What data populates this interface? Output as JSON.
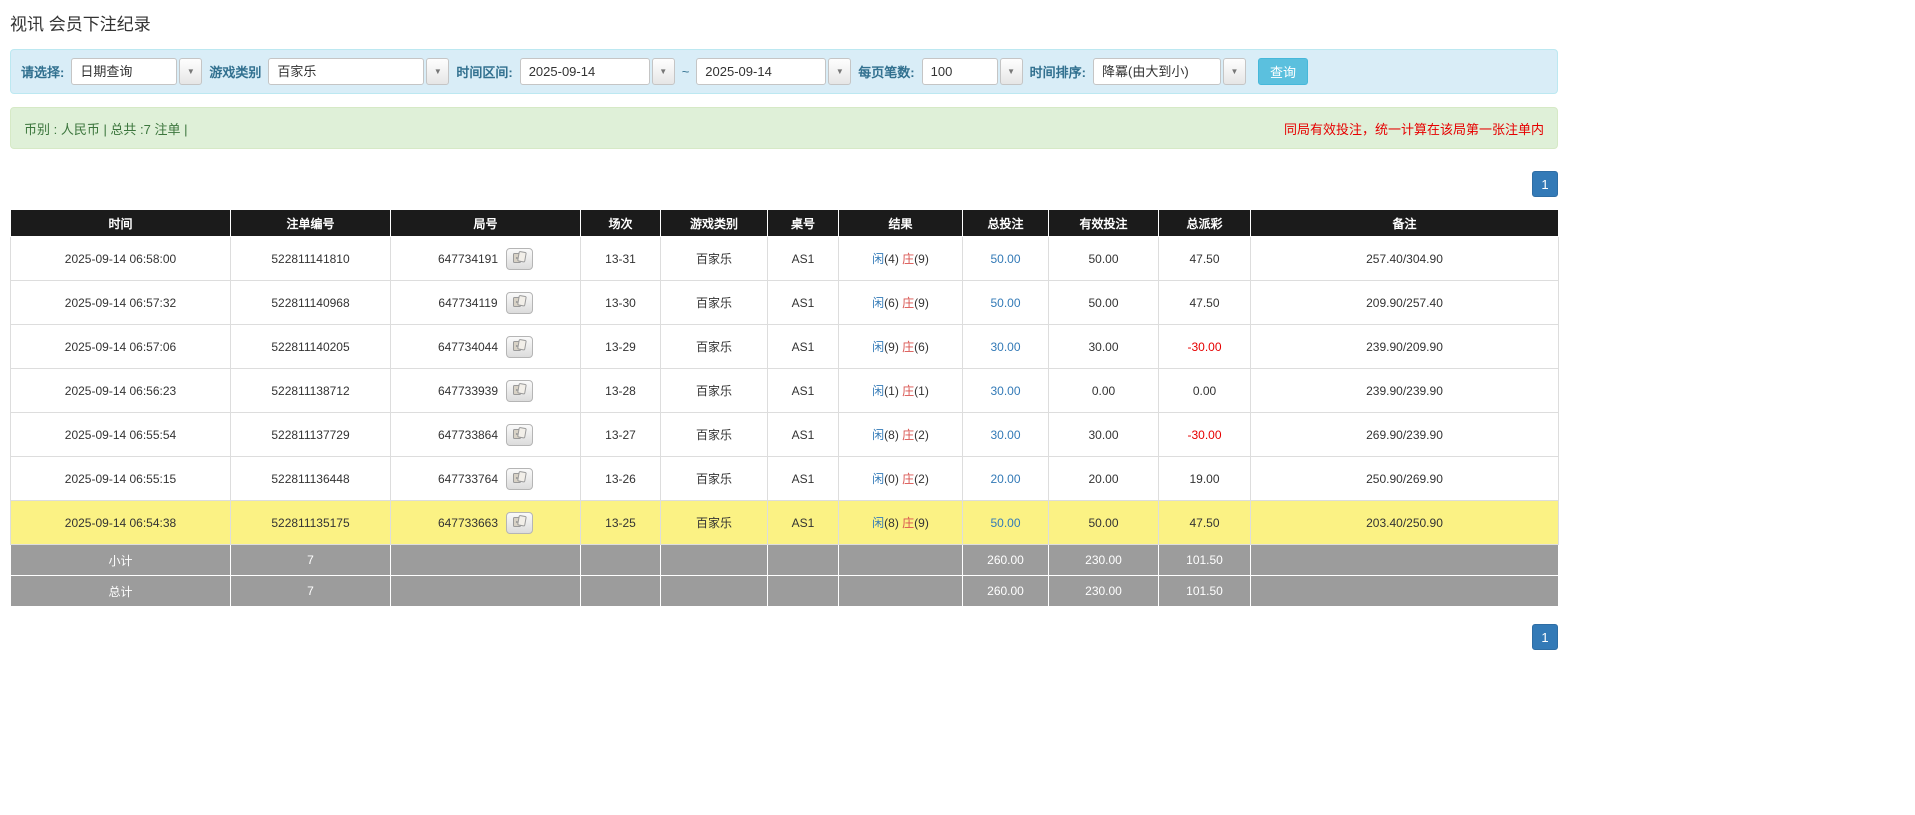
{
  "page_title": "视讯 会员下注纪录",
  "filters": {
    "select_label": "请选择:",
    "select_value": "日期查询",
    "game_type_label": "游戏类别",
    "game_type_value": "百家乐",
    "date_range_label": "时间区间:",
    "date_from": "2025-09-14",
    "range_separator": "~",
    "date_to": "2025-09-14",
    "per_page_label": "每页笔数:",
    "per_page_value": "100",
    "sort_label": "时间排序:",
    "sort_value": "降冪(由大到小)",
    "search_button_label": "查询",
    "caret_glyph": "▼"
  },
  "summary": {
    "left_text": "币别 : 人民币 | 总共 :7 注单 |",
    "note": "同局有效投注，统一计算在该局第一张注单内"
  },
  "pagination": {
    "page": "1"
  },
  "table": {
    "headers": [
      "时间",
      "注单编号",
      "局号",
      "场次",
      "游戏类别",
      "桌号",
      "结果",
      "总投注",
      "有效投注",
      "总派彩",
      "备注"
    ],
    "result_labels": {
      "player": "闲",
      "banker": "庄"
    },
    "rows": [
      {
        "time": "2025-09-14 06:58:00",
        "bet_id": "522811141810",
        "round": "647734191",
        "session": "13-31",
        "game": "百家乐",
        "table_no": "AS1",
        "player": "4",
        "banker": "9",
        "total_bet": "50.00",
        "valid_bet": "50.00",
        "payout": "47.50",
        "remark": "257.40/304.90",
        "highlight": false
      },
      {
        "time": "2025-09-14 06:57:32",
        "bet_id": "522811140968",
        "round": "647734119",
        "session": "13-30",
        "game": "百家乐",
        "table_no": "AS1",
        "player": "6",
        "banker": "9",
        "total_bet": "50.00",
        "valid_bet": "50.00",
        "payout": "47.50",
        "remark": "209.90/257.40",
        "highlight": false
      },
      {
        "time": "2025-09-14 06:57:06",
        "bet_id": "522811140205",
        "round": "647734044",
        "session": "13-29",
        "game": "百家乐",
        "table_no": "AS1",
        "player": "9",
        "banker": "6",
        "total_bet": "30.00",
        "valid_bet": "30.00",
        "payout": "-30.00",
        "remark": "239.90/209.90",
        "highlight": false
      },
      {
        "time": "2025-09-14 06:56:23",
        "bet_id": "522811138712",
        "round": "647733939",
        "session": "13-28",
        "game": "百家乐",
        "table_no": "AS1",
        "player": "1",
        "banker": "1",
        "total_bet": "30.00",
        "valid_bet": "0.00",
        "payout": "0.00",
        "remark": "239.90/239.90",
        "highlight": false
      },
      {
        "time": "2025-09-14 06:55:54",
        "bet_id": "522811137729",
        "round": "647733864",
        "session": "13-27",
        "game": "百家乐",
        "table_no": "AS1",
        "player": "8",
        "banker": "2",
        "total_bet": "30.00",
        "valid_bet": "30.00",
        "payout": "-30.00",
        "remark": "269.90/239.90",
        "highlight": false
      },
      {
        "time": "2025-09-14 06:55:15",
        "bet_id": "522811136448",
        "round": "647733764",
        "session": "13-26",
        "game": "百家乐",
        "table_no": "AS1",
        "player": "0",
        "banker": "2",
        "total_bet": "20.00",
        "valid_bet": "20.00",
        "payout": "19.00",
        "remark": "250.90/269.90",
        "highlight": false
      },
      {
        "time": "2025-09-14 06:54:38",
        "bet_id": "522811135175",
        "round": "647733663",
        "session": "13-25",
        "game": "百家乐",
        "table_no": "AS1",
        "player": "8",
        "banker": "9",
        "total_bet": "50.00",
        "valid_bet": "50.00",
        "payout": "47.50",
        "remark": "203.40/250.90",
        "highlight": true
      }
    ],
    "subtotal": {
      "label": "小计",
      "count": "7",
      "total_bet": "260.00",
      "valid_bet": "230.00",
      "payout": "101.50"
    },
    "grand_total": {
      "label": "总计",
      "count": "7",
      "total_bet": "260.00",
      "valid_bet": "230.00",
      "payout": "101.50"
    }
  },
  "icons": {
    "combo_caret": "chevron-down-icon",
    "round_detail": "cards-icon"
  },
  "colors": {
    "accent_blue": "#337ab7",
    "info_button_blue": "#5bc0de",
    "note_red": "#e60000",
    "negative_red": "#e60000",
    "player_blue": "#337ab7",
    "banker_red": "#d9534f",
    "highlight_yellow": "#fbf284",
    "header_bg": "#1b1b1b",
    "footer_bg": "#9c9c9c",
    "filter_bar_bg": "#d9edf7",
    "summary_bar_bg": "#dff0d8"
  }
}
